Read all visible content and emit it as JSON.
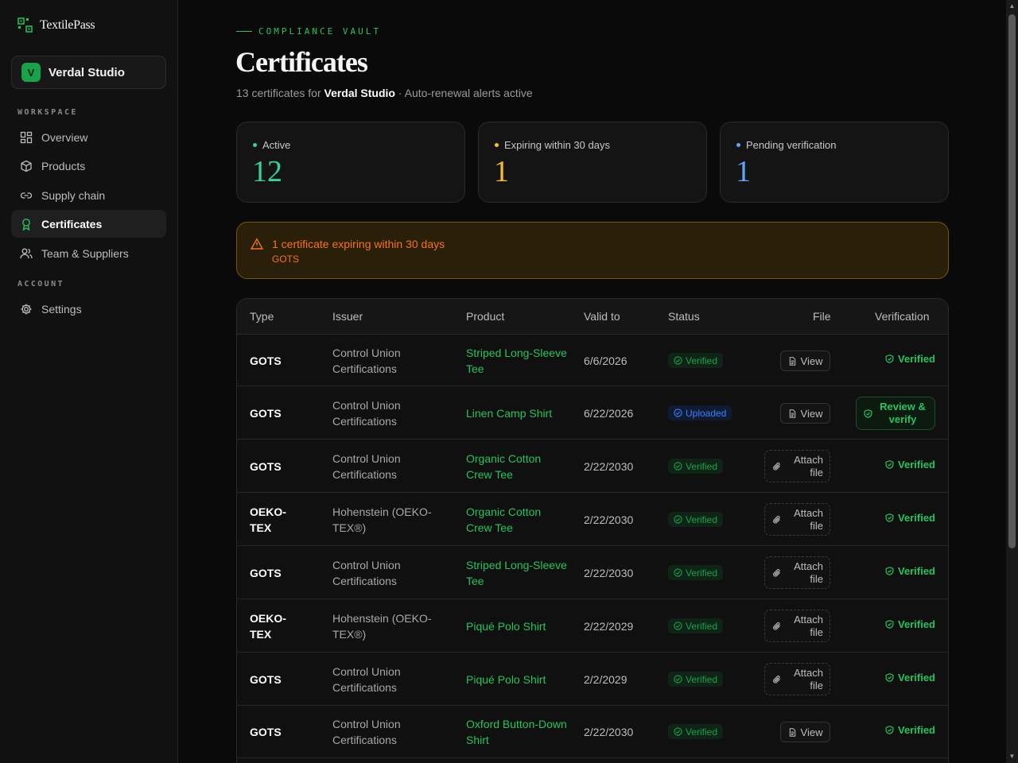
{
  "brand": {
    "name": "TextilePass"
  },
  "workspace": {
    "initial": "V",
    "name": "Verdal Studio"
  },
  "nav": {
    "workspace_label": "WORKSPACE",
    "account_label": "ACCOUNT",
    "items": [
      {
        "label": "Overview",
        "icon": "grid-icon"
      },
      {
        "label": "Products",
        "icon": "box-icon"
      },
      {
        "label": "Supply chain",
        "icon": "link-icon"
      },
      {
        "label": "Certificates",
        "icon": "award-icon",
        "active": true
      },
      {
        "label": "Team & Suppliers",
        "icon": "users-icon"
      }
    ],
    "account_items": [
      {
        "label": "Settings",
        "icon": "gear-icon"
      }
    ]
  },
  "header": {
    "eyebrow": "COMPLIANCE VAULT",
    "title": "Certificates",
    "subtitle_prefix": "13 certificates for",
    "subtitle_org": "Verdal Studio",
    "subtitle_suffix": "· Auto-renewal alerts active"
  },
  "stats": [
    {
      "label": "Active",
      "value": "12",
      "color": "#34d399"
    },
    {
      "label": "Expiring within 30 days",
      "value": "1",
      "color": "#fbbf24"
    },
    {
      "label": "Pending verification",
      "value": "1",
      "color": "#60a5fa"
    }
  ],
  "alert": {
    "title": "1 certificate expiring within 30 days",
    "detail": "GOTS"
  },
  "table": {
    "columns": [
      "Type",
      "Issuer",
      "Product",
      "Valid to",
      "Status",
      "File",
      "Verification"
    ],
    "rows": [
      {
        "type": "GOTS",
        "issuer": "Control Union Certifications",
        "product": "Striped Long-Sleeve Tee",
        "valid_to": "6/6/2026",
        "status": "Verified",
        "file": "View",
        "verification": "Verified"
      },
      {
        "type": "GOTS",
        "issuer": "Control Union Certifications",
        "product": "Linen Camp Shirt",
        "valid_to": "6/22/2026",
        "status": "Uploaded",
        "file": "View",
        "verification": "Review & verify"
      },
      {
        "type": "GOTS",
        "issuer": "Control Union Certifications",
        "product": "Organic Cotton Crew Tee",
        "valid_to": "2/22/2030",
        "status": "Verified",
        "file": "Attach file",
        "verification": "Verified"
      },
      {
        "type": "OEKO-TEX",
        "issuer": "Hohenstein (OEKO-TEX®)",
        "product": "Organic Cotton Crew Tee",
        "valid_to": "2/22/2030",
        "status": "Verified",
        "file": "Attach file",
        "verification": "Verified"
      },
      {
        "type": "GOTS",
        "issuer": "Control Union Certifications",
        "product": "Striped Long-Sleeve Tee",
        "valid_to": "2/22/2030",
        "status": "Verified",
        "file": "Attach file",
        "verification": "Verified"
      },
      {
        "type": "OEKO-TEX",
        "issuer": "Hohenstein (OEKO-TEX®)",
        "product": "Piqué Polo Shirt",
        "valid_to": "2/22/2029",
        "status": "Verified",
        "file": "Attach file",
        "verification": "Verified"
      },
      {
        "type": "GOTS",
        "issuer": "Control Union Certifications",
        "product": "Piqué Polo Shirt",
        "valid_to": "2/2/2029",
        "status": "Verified",
        "file": "Attach file",
        "verification": "Verified"
      },
      {
        "type": "GOTS",
        "issuer": "Control Union Certifications",
        "product": "Oxford Button-Down Shirt",
        "valid_to": "2/22/2030",
        "status": "Verified",
        "file": "View",
        "verification": "Verified"
      }
    ]
  }
}
